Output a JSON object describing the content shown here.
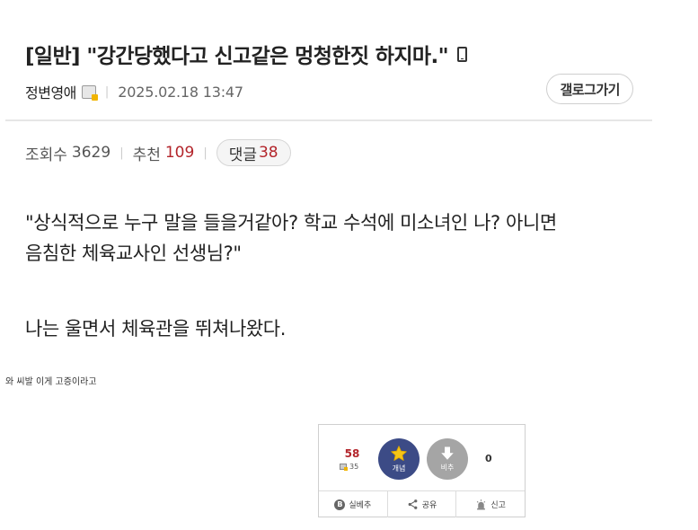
{
  "post": {
    "title": "[일반] \"강간당했다고 신고같은 멍청한짓 하지마.\"",
    "author": "정변영애",
    "date": "2025.02.18 13:47",
    "gallog_button": "갤로그가기"
  },
  "stats": {
    "views_label": "조회수",
    "views": "3629",
    "recommend_label": "추천",
    "recommend": "109",
    "comments_label": "댓글",
    "comments": "38"
  },
  "content": {
    "line1": "\"상식적으로 누구 말을 들을거같아? 학교 수석에 미소녀인 나? 아니면",
    "line2": "음침한 체육교사인 선생님?\"",
    "line3": "나는 울면서 체육관을 뛰쳐나왔다.",
    "small_comment": "와 씨발 이게 고증이라고"
  },
  "vote": {
    "up_count": "58",
    "fixed_count": "35",
    "up_label": "개념",
    "down_label": "비추",
    "down_count": "0",
    "real_recommend_label": "실베추",
    "share_label": "공유",
    "report_label": "신고"
  },
  "colors": {
    "accent_red": "#b3252b",
    "vote_up_bg": "#3c4b86",
    "vote_down_bg": "#a5a5a5",
    "star": "#f5c518"
  },
  "icons": [
    "mobile-icon",
    "fixed-user-icon",
    "star-icon",
    "down-arrow-icon",
    "share-icon",
    "siren-icon",
    "b-badge-icon"
  ]
}
